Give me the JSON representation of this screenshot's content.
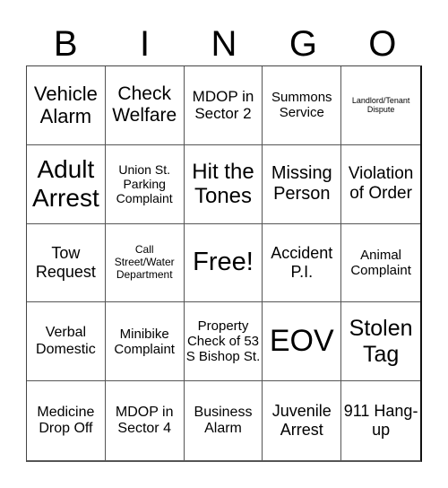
{
  "header": [
    "B",
    "I",
    "N",
    "G",
    "O"
  ],
  "cells": [
    {
      "text": "Vehicle Alarm",
      "size": 22
    },
    {
      "text": "Check Welfare",
      "size": 21
    },
    {
      "text": "MDOP in Sector 2",
      "size": 17
    },
    {
      "text": "Summons Service",
      "size": 15
    },
    {
      "text": "Landlord/Tenant Dispute",
      "size": 9
    },
    {
      "text": "Adult Arrest",
      "size": 28
    },
    {
      "text": "Union St. Parking Complaint",
      "size": 14
    },
    {
      "text": "Hit the Tones",
      "size": 24
    },
    {
      "text": "Missing Person",
      "size": 20
    },
    {
      "text": "Violation of Order",
      "size": 19
    },
    {
      "text": "Tow Request",
      "size": 18
    },
    {
      "text": "Call Street/Water Department",
      "size": 12
    },
    {
      "text": "Free!",
      "size": 29
    },
    {
      "text": "Accident P.I.",
      "size": 18
    },
    {
      "text": "Animal Complaint",
      "size": 15
    },
    {
      "text": "Verbal Domestic",
      "size": 16
    },
    {
      "text": "Minibike Complaint",
      "size": 15
    },
    {
      "text": "Property Check of 53 S Bishop St.",
      "size": 15
    },
    {
      "text": "EOV",
      "size": 34
    },
    {
      "text": "Stolen Tag",
      "size": 25
    },
    {
      "text": "Medicine Drop Off",
      "size": 16
    },
    {
      "text": "MDOP in Sector 4",
      "size": 16
    },
    {
      "text": "Business Alarm",
      "size": 16
    },
    {
      "text": "Juvenile Arrest",
      "size": 18
    },
    {
      "text": "911 Hang-up",
      "size": 18
    }
  ]
}
